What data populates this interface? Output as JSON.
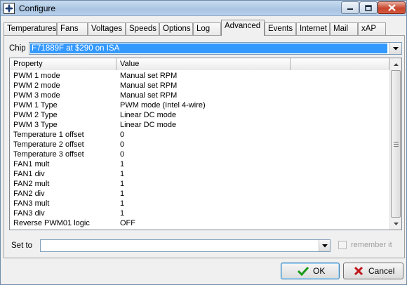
{
  "window": {
    "title": "Configure"
  },
  "tabs": [
    {
      "label": "Temperatures",
      "active": false
    },
    {
      "label": "Fans",
      "active": false
    },
    {
      "label": "Voltages",
      "active": false
    },
    {
      "label": "Speeds",
      "active": false
    },
    {
      "label": "Options",
      "active": false
    },
    {
      "label": "Log",
      "active": false
    },
    {
      "label": "Advanced",
      "active": true
    },
    {
      "label": "Events",
      "active": false
    },
    {
      "label": "Internet",
      "active": false
    },
    {
      "label": "Mail",
      "active": false
    },
    {
      "label": "xAP",
      "active": false
    }
  ],
  "chip": {
    "label": "Chip",
    "selected": "F71889F at $290 on ISA"
  },
  "grid": {
    "columns": [
      "Property",
      "Value",
      ""
    ],
    "rows": [
      {
        "property": "PWM 1 mode",
        "value": "Manual set RPM"
      },
      {
        "property": "PWM 2 mode",
        "value": "Manual set RPM"
      },
      {
        "property": "PWM 3 mode",
        "value": "Manual set RPM"
      },
      {
        "property": "PWM 1 Type",
        "value": "PWM mode (Intel 4-wire)"
      },
      {
        "property": "PWM 2 Type",
        "value": "Linear DC mode"
      },
      {
        "property": "PWM 3 Type",
        "value": "Linear DC mode"
      },
      {
        "property": "Temperature 1 offset",
        "value": "0"
      },
      {
        "property": "Temperature 2 offset",
        "value": "0"
      },
      {
        "property": "Temperature 3 offset",
        "value": "0"
      },
      {
        "property": "FAN1 mult",
        "value": "1"
      },
      {
        "property": "FAN1 div",
        "value": "1"
      },
      {
        "property": "FAN2 mult",
        "value": "1"
      },
      {
        "property": "FAN2 div",
        "value": "1"
      },
      {
        "property": "FAN3 mult",
        "value": "1"
      },
      {
        "property": "FAN3 div",
        "value": "1"
      },
      {
        "property": "Reverse PWM01 logic",
        "value": "OFF"
      }
    ]
  },
  "set_to": {
    "label": "Set to",
    "value": ""
  },
  "remember": {
    "label": "remember it",
    "checked": false,
    "enabled": false
  },
  "buttons": {
    "ok": "OK",
    "cancel": "Cancel"
  },
  "colors": {
    "selection": "#3399ff",
    "ok_check": "#1a9a1a",
    "cancel_x": "#c0181c"
  }
}
